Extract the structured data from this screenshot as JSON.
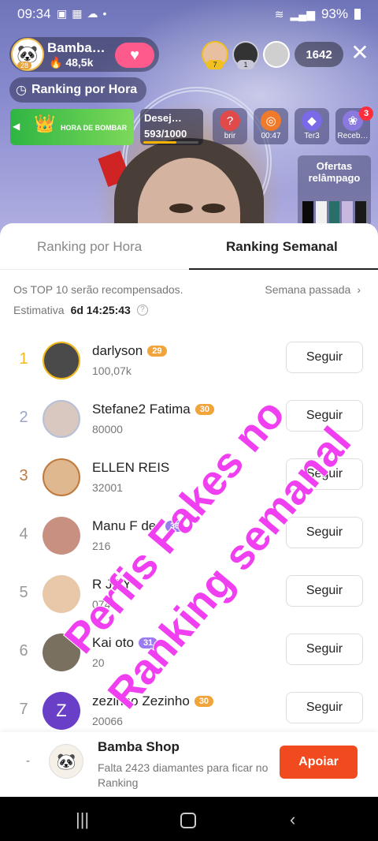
{
  "status_bar": {
    "time": "09:34",
    "battery": "93%"
  },
  "host": {
    "name": "Bamba…",
    "likes": "48,5k",
    "level": "28"
  },
  "viewers": [
    {
      "badge": "7"
    },
    {
      "badge": "1"
    },
    {
      "badge": ""
    }
  ],
  "viewer_count": "1642",
  "ranking_hour_pill": "Ranking por Hora",
  "banner": {
    "label": "HORA DE BOMBAR"
  },
  "wish": {
    "title": "Desej…",
    "count": "593/1000",
    "progress": 0.593
  },
  "events": [
    {
      "label": "brir"
    },
    {
      "label": "00:47"
    },
    {
      "label": "Ter3"
    },
    {
      "label": "Receb…",
      "badge": "3"
    }
  ],
  "flash_offer": "Ofertas relâmpago",
  "tabs": {
    "hour": "Ranking por Hora",
    "week": "Ranking Semanal"
  },
  "info": {
    "top10": "Os TOP 10 serão recompensados.",
    "last_week": "Semana passada",
    "estimate_label": "Estimativa",
    "countdown": "6d 14:25:43"
  },
  "rows": [
    {
      "rank": "1",
      "name": "darlyson",
      "level": "29",
      "score": "100,07k",
      "follow": "Seguir",
      "rank_color": "#f2b91a",
      "badge_color": "#f0a43a"
    },
    {
      "rank": "2",
      "name": "Stefane2 Fatima",
      "level": "30",
      "score": "80000",
      "follow": "Seguir",
      "rank_color": "#9aa6c8",
      "badge_color": "#f0a43a"
    },
    {
      "rank": "3",
      "name": "ELLEN REIS",
      "level": "",
      "score": "32001",
      "follow": "Seguir",
      "rank_color": "#c07a3e",
      "badge_color": "#f0a43a"
    },
    {
      "rank": "4",
      "name": "Manu F    der",
      "level": "36",
      "score": "216",
      "follow": "Seguir",
      "rank_color": "#999999",
      "badge_color": "#9a7cf0"
    },
    {
      "rank": "5",
      "name": "    R JOY",
      "level": "",
      "score": "   074",
      "follow": "Seguir",
      "rank_color": "#999999",
      "badge_color": "#f0a43a"
    },
    {
      "rank": "6",
      "name": "Kai     oto",
      "level": "31",
      "score": "20",
      "follow": "Seguir",
      "rank_color": "#999999",
      "badge_color": "#9a7cf0"
    },
    {
      "rank": "7",
      "name": "zezinho Zezinho",
      "level": "30",
      "score": "20066",
      "follow": "Seguir",
      "rank_color": "#999999",
      "badge_color": "#f0a43a"
    }
  ],
  "self": {
    "rank": "-",
    "name": "Bamba Shop",
    "hint": "Falta 2423 diamantes para ficar no Ranking",
    "support": "Apoiar"
  },
  "overlay": {
    "line1": "Perfis Fakes no",
    "line2": "Ranking semanal"
  }
}
